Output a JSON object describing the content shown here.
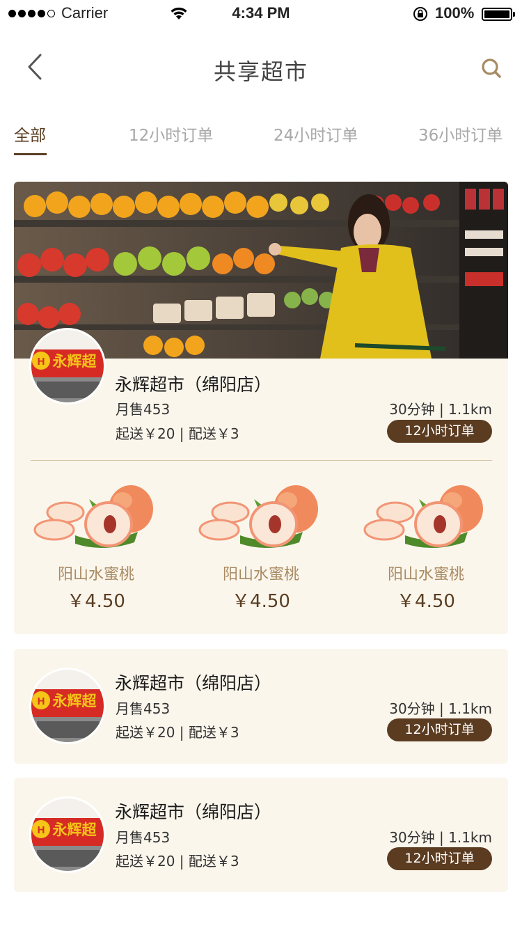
{
  "status_bar": {
    "carrier": "Carrier",
    "time": "4:34 PM",
    "battery": "100%"
  },
  "nav": {
    "title": "共享超市",
    "back_icon": "chevron-left-icon",
    "search_icon": "search-icon"
  },
  "tabs": [
    {
      "label": "全部",
      "active": true
    },
    {
      "label": "12小时订单",
      "active": false
    },
    {
      "label": "24小时订单",
      "active": false
    },
    {
      "label": "36小时订单",
      "active": false
    }
  ],
  "stores": [
    {
      "name": "永辉超市（绵阳店）",
      "monthly_sales": "月售453",
      "delivery": "起送￥20 | 配送￥3",
      "eta": "30分钟 | 1.1km",
      "badge": "12小时订单",
      "logo_text": "永辉超市",
      "products": [
        {
          "name": "阳山水蜜桃",
          "price": "￥4.50"
        },
        {
          "name": "阳山水蜜桃",
          "price": "￥4.50"
        },
        {
          "name": "阳山水蜜桃",
          "price": "￥4.50"
        }
      ]
    },
    {
      "name": "永辉超市（绵阳店）",
      "monthly_sales": "月售453",
      "delivery": "起送￥20 | 配送￥3",
      "eta": "30分钟 | 1.1km",
      "badge": "12小时订单",
      "logo_text": "永辉超市"
    },
    {
      "name": "永辉超市（绵阳店）",
      "monthly_sales": "月售453",
      "delivery": "起送￥20 | 配送￥3",
      "eta": "30分钟 | 1.1km",
      "badge": "12小时订单",
      "logo_text": "永辉超市"
    }
  ],
  "colors": {
    "accent": "#5b3c21",
    "card_bg": "#fbf6ec",
    "product_name": "#a88a62",
    "search_icon": "#a88a62"
  }
}
